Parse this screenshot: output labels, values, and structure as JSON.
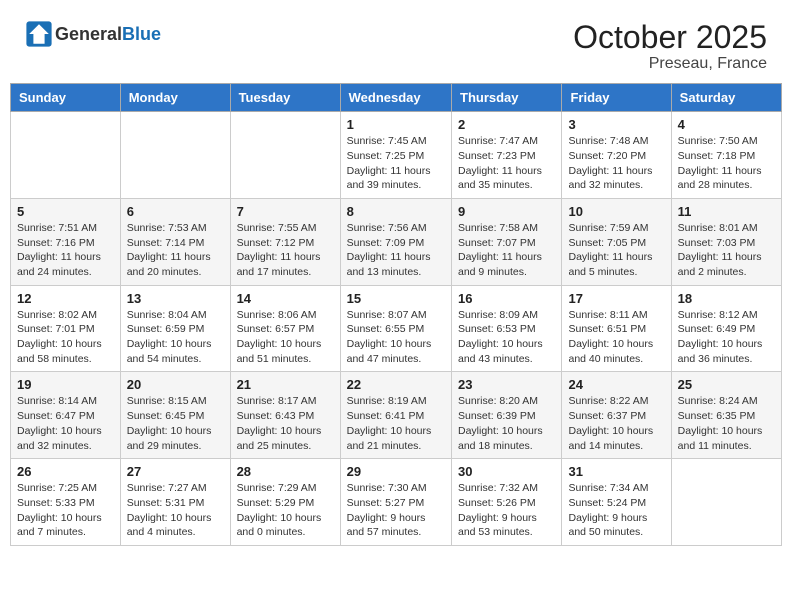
{
  "header": {
    "logo_general": "General",
    "logo_blue": "Blue",
    "month": "October 2025",
    "location": "Preseau, France"
  },
  "days_of_week": [
    "Sunday",
    "Monday",
    "Tuesday",
    "Wednesday",
    "Thursday",
    "Friday",
    "Saturday"
  ],
  "weeks": [
    [
      {
        "day": "",
        "info": ""
      },
      {
        "day": "",
        "info": ""
      },
      {
        "day": "",
        "info": ""
      },
      {
        "day": "1",
        "info": "Sunrise: 7:45 AM\nSunset: 7:25 PM\nDaylight: 11 hours\nand 39 minutes."
      },
      {
        "day": "2",
        "info": "Sunrise: 7:47 AM\nSunset: 7:23 PM\nDaylight: 11 hours\nand 35 minutes."
      },
      {
        "day": "3",
        "info": "Sunrise: 7:48 AM\nSunset: 7:20 PM\nDaylight: 11 hours\nand 32 minutes."
      },
      {
        "day": "4",
        "info": "Sunrise: 7:50 AM\nSunset: 7:18 PM\nDaylight: 11 hours\nand 28 minutes."
      }
    ],
    [
      {
        "day": "5",
        "info": "Sunrise: 7:51 AM\nSunset: 7:16 PM\nDaylight: 11 hours\nand 24 minutes."
      },
      {
        "day": "6",
        "info": "Sunrise: 7:53 AM\nSunset: 7:14 PM\nDaylight: 11 hours\nand 20 minutes."
      },
      {
        "day": "7",
        "info": "Sunrise: 7:55 AM\nSunset: 7:12 PM\nDaylight: 11 hours\nand 17 minutes."
      },
      {
        "day": "8",
        "info": "Sunrise: 7:56 AM\nSunset: 7:09 PM\nDaylight: 11 hours\nand 13 minutes."
      },
      {
        "day": "9",
        "info": "Sunrise: 7:58 AM\nSunset: 7:07 PM\nDaylight: 11 hours\nand 9 minutes."
      },
      {
        "day": "10",
        "info": "Sunrise: 7:59 AM\nSunset: 7:05 PM\nDaylight: 11 hours\nand 5 minutes."
      },
      {
        "day": "11",
        "info": "Sunrise: 8:01 AM\nSunset: 7:03 PM\nDaylight: 11 hours\nand 2 minutes."
      }
    ],
    [
      {
        "day": "12",
        "info": "Sunrise: 8:02 AM\nSunset: 7:01 PM\nDaylight: 10 hours\nand 58 minutes."
      },
      {
        "day": "13",
        "info": "Sunrise: 8:04 AM\nSunset: 6:59 PM\nDaylight: 10 hours\nand 54 minutes."
      },
      {
        "day": "14",
        "info": "Sunrise: 8:06 AM\nSunset: 6:57 PM\nDaylight: 10 hours\nand 51 minutes."
      },
      {
        "day": "15",
        "info": "Sunrise: 8:07 AM\nSunset: 6:55 PM\nDaylight: 10 hours\nand 47 minutes."
      },
      {
        "day": "16",
        "info": "Sunrise: 8:09 AM\nSunset: 6:53 PM\nDaylight: 10 hours\nand 43 minutes."
      },
      {
        "day": "17",
        "info": "Sunrise: 8:11 AM\nSunset: 6:51 PM\nDaylight: 10 hours\nand 40 minutes."
      },
      {
        "day": "18",
        "info": "Sunrise: 8:12 AM\nSunset: 6:49 PM\nDaylight: 10 hours\nand 36 minutes."
      }
    ],
    [
      {
        "day": "19",
        "info": "Sunrise: 8:14 AM\nSunset: 6:47 PM\nDaylight: 10 hours\nand 32 minutes."
      },
      {
        "day": "20",
        "info": "Sunrise: 8:15 AM\nSunset: 6:45 PM\nDaylight: 10 hours\nand 29 minutes."
      },
      {
        "day": "21",
        "info": "Sunrise: 8:17 AM\nSunset: 6:43 PM\nDaylight: 10 hours\nand 25 minutes."
      },
      {
        "day": "22",
        "info": "Sunrise: 8:19 AM\nSunset: 6:41 PM\nDaylight: 10 hours\nand 21 minutes."
      },
      {
        "day": "23",
        "info": "Sunrise: 8:20 AM\nSunset: 6:39 PM\nDaylight: 10 hours\nand 18 minutes."
      },
      {
        "day": "24",
        "info": "Sunrise: 8:22 AM\nSunset: 6:37 PM\nDaylight: 10 hours\nand 14 minutes."
      },
      {
        "day": "25",
        "info": "Sunrise: 8:24 AM\nSunset: 6:35 PM\nDaylight: 10 hours\nand 11 minutes."
      }
    ],
    [
      {
        "day": "26",
        "info": "Sunrise: 7:25 AM\nSunset: 5:33 PM\nDaylight: 10 hours\nand 7 minutes."
      },
      {
        "day": "27",
        "info": "Sunrise: 7:27 AM\nSunset: 5:31 PM\nDaylight: 10 hours\nand 4 minutes."
      },
      {
        "day": "28",
        "info": "Sunrise: 7:29 AM\nSunset: 5:29 PM\nDaylight: 10 hours\nand 0 minutes."
      },
      {
        "day": "29",
        "info": "Sunrise: 7:30 AM\nSunset: 5:27 PM\nDaylight: 9 hours\nand 57 minutes."
      },
      {
        "day": "30",
        "info": "Sunrise: 7:32 AM\nSunset: 5:26 PM\nDaylight: 9 hours\nand 53 minutes."
      },
      {
        "day": "31",
        "info": "Sunrise: 7:34 AM\nSunset: 5:24 PM\nDaylight: 9 hours\nand 50 minutes."
      },
      {
        "day": "",
        "info": ""
      }
    ]
  ]
}
